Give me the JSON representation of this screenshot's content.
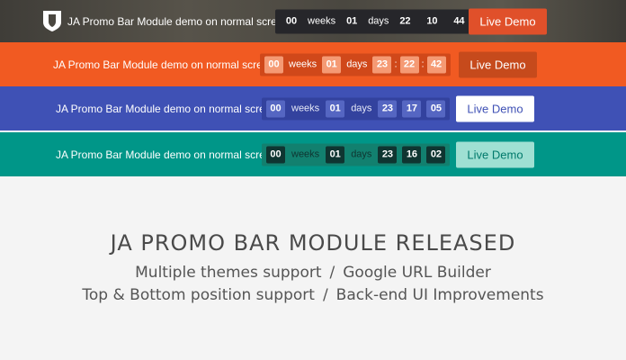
{
  "bars": [
    {
      "message": "JA Promo Bar Module demo on normal screen",
      "countdown": {
        "weeks_value": "00",
        "weeks_label": "weeks",
        "days_value": "01",
        "days_label": "days",
        "hours": "22",
        "minutes": "10",
        "seconds": "44"
      },
      "button_label": "Live Demo"
    },
    {
      "message": "JA Promo Bar Module demo on normal screen",
      "countdown": {
        "weeks_value": "00",
        "weeks_label": "weeks",
        "days_value": "01",
        "days_label": "days",
        "hours": "23",
        "minutes": "22",
        "seconds": "42"
      },
      "button_label": "Live Demo"
    },
    {
      "message": "JA Promo Bar Module demo on normal screen",
      "countdown": {
        "weeks_value": "00",
        "weeks_label": "weeks",
        "days_value": "01",
        "days_label": "days",
        "hours": "23",
        "minutes": "17",
        "seconds": "05"
      },
      "button_label": "Live Demo"
    },
    {
      "message": "JA Promo Bar Module demo on normal screen",
      "countdown": {
        "weeks_value": "00",
        "weeks_label": "weeks",
        "days_value": "01",
        "days_label": "days",
        "hours": "23",
        "minutes": "16",
        "seconds": "02"
      },
      "button_label": "Live Demo"
    }
  ],
  "colon": ":",
  "headline": "JA PROMO BAR MODULE RELEASED",
  "features": {
    "line1": [
      "Multiple themes support",
      "Google URL Builder"
    ],
    "line2": [
      "Top & Bottom position support",
      "Back-end UI Improvements"
    ],
    "separator": "/"
  },
  "colors": {
    "bar_orange": "#f15a22",
    "bar_indigo": "#3f51b5",
    "bar_teal": "#009688",
    "button_dark_orange": "#e0502a"
  },
  "icons": {
    "logo": "shield-logo-icon"
  }
}
